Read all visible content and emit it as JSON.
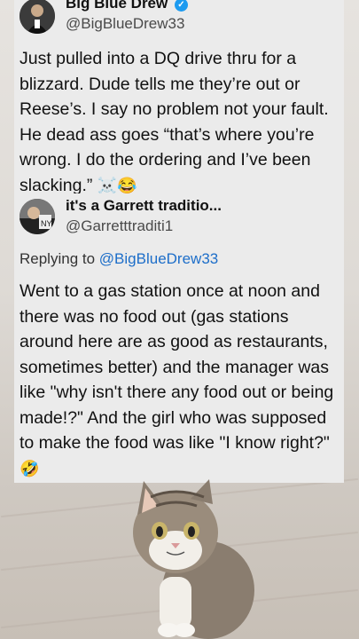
{
  "tweet": {
    "name": "Big Blue Drew",
    "handle": "@BigBlueDrew33",
    "text": "Just pulled into a DQ drive thru for a blizzard. Dude tells me they’re out or Reese’s. I say no problem not your fault. He dead ass goes “that’s where you’re wrong. I do the ordering and I’ve been slacking.”",
    "emojis": "☠️😂"
  },
  "reply": {
    "name": "it's a Garrett traditio...",
    "handle": "@Garretttraditi1",
    "replying_prefix": "Replying to",
    "replying_to": "@BigBlueDrew33",
    "text": "Went to a gas station once at noon and there was no food out (gas stations around here are as good as restaurants, sometimes better) and the manager was like \"why isn't there any food out or being made!?\" And the girl who was supposed to make the food was like \"I know right?\"",
    "emoji": "🤣"
  },
  "colors": {
    "mention": "#1d6ec9",
    "verified": "#1d9bf0"
  },
  "icons": {
    "verified": "verified-badge-icon"
  }
}
